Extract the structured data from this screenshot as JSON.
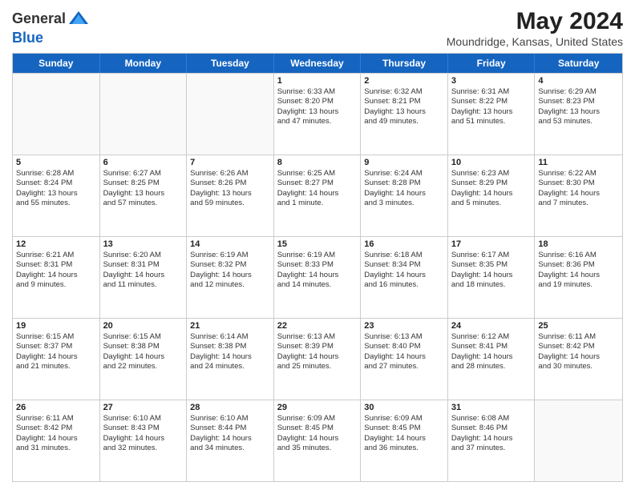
{
  "header": {
    "logo_line1": "General",
    "logo_line2": "Blue",
    "title": "May 2024",
    "subtitle": "Moundridge, Kansas, United States"
  },
  "weekdays": [
    "Sunday",
    "Monday",
    "Tuesday",
    "Wednesday",
    "Thursday",
    "Friday",
    "Saturday"
  ],
  "rows": [
    [
      {
        "day": "",
        "lines": [],
        "empty": true
      },
      {
        "day": "",
        "lines": [],
        "empty": true
      },
      {
        "day": "",
        "lines": [],
        "empty": true
      },
      {
        "day": "1",
        "lines": [
          "Sunrise: 6:33 AM",
          "Sunset: 8:20 PM",
          "Daylight: 13 hours",
          "and 47 minutes."
        ],
        "empty": false
      },
      {
        "day": "2",
        "lines": [
          "Sunrise: 6:32 AM",
          "Sunset: 8:21 PM",
          "Daylight: 13 hours",
          "and 49 minutes."
        ],
        "empty": false
      },
      {
        "day": "3",
        "lines": [
          "Sunrise: 6:31 AM",
          "Sunset: 8:22 PM",
          "Daylight: 13 hours",
          "and 51 minutes."
        ],
        "empty": false
      },
      {
        "day": "4",
        "lines": [
          "Sunrise: 6:29 AM",
          "Sunset: 8:23 PM",
          "Daylight: 13 hours",
          "and 53 minutes."
        ],
        "empty": false
      }
    ],
    [
      {
        "day": "5",
        "lines": [
          "Sunrise: 6:28 AM",
          "Sunset: 8:24 PM",
          "Daylight: 13 hours",
          "and 55 minutes."
        ],
        "empty": false
      },
      {
        "day": "6",
        "lines": [
          "Sunrise: 6:27 AM",
          "Sunset: 8:25 PM",
          "Daylight: 13 hours",
          "and 57 minutes."
        ],
        "empty": false
      },
      {
        "day": "7",
        "lines": [
          "Sunrise: 6:26 AM",
          "Sunset: 8:26 PM",
          "Daylight: 13 hours",
          "and 59 minutes."
        ],
        "empty": false
      },
      {
        "day": "8",
        "lines": [
          "Sunrise: 6:25 AM",
          "Sunset: 8:27 PM",
          "Daylight: 14 hours",
          "and 1 minute."
        ],
        "empty": false
      },
      {
        "day": "9",
        "lines": [
          "Sunrise: 6:24 AM",
          "Sunset: 8:28 PM",
          "Daylight: 14 hours",
          "and 3 minutes."
        ],
        "empty": false
      },
      {
        "day": "10",
        "lines": [
          "Sunrise: 6:23 AM",
          "Sunset: 8:29 PM",
          "Daylight: 14 hours",
          "and 5 minutes."
        ],
        "empty": false
      },
      {
        "day": "11",
        "lines": [
          "Sunrise: 6:22 AM",
          "Sunset: 8:30 PM",
          "Daylight: 14 hours",
          "and 7 minutes."
        ],
        "empty": false
      }
    ],
    [
      {
        "day": "12",
        "lines": [
          "Sunrise: 6:21 AM",
          "Sunset: 8:31 PM",
          "Daylight: 14 hours",
          "and 9 minutes."
        ],
        "empty": false
      },
      {
        "day": "13",
        "lines": [
          "Sunrise: 6:20 AM",
          "Sunset: 8:31 PM",
          "Daylight: 14 hours",
          "and 11 minutes."
        ],
        "empty": false
      },
      {
        "day": "14",
        "lines": [
          "Sunrise: 6:19 AM",
          "Sunset: 8:32 PM",
          "Daylight: 14 hours",
          "and 12 minutes."
        ],
        "empty": false
      },
      {
        "day": "15",
        "lines": [
          "Sunrise: 6:19 AM",
          "Sunset: 8:33 PM",
          "Daylight: 14 hours",
          "and 14 minutes."
        ],
        "empty": false
      },
      {
        "day": "16",
        "lines": [
          "Sunrise: 6:18 AM",
          "Sunset: 8:34 PM",
          "Daylight: 14 hours",
          "and 16 minutes."
        ],
        "empty": false
      },
      {
        "day": "17",
        "lines": [
          "Sunrise: 6:17 AM",
          "Sunset: 8:35 PM",
          "Daylight: 14 hours",
          "and 18 minutes."
        ],
        "empty": false
      },
      {
        "day": "18",
        "lines": [
          "Sunrise: 6:16 AM",
          "Sunset: 8:36 PM",
          "Daylight: 14 hours",
          "and 19 minutes."
        ],
        "empty": false
      }
    ],
    [
      {
        "day": "19",
        "lines": [
          "Sunrise: 6:15 AM",
          "Sunset: 8:37 PM",
          "Daylight: 14 hours",
          "and 21 minutes."
        ],
        "empty": false
      },
      {
        "day": "20",
        "lines": [
          "Sunrise: 6:15 AM",
          "Sunset: 8:38 PM",
          "Daylight: 14 hours",
          "and 22 minutes."
        ],
        "empty": false
      },
      {
        "day": "21",
        "lines": [
          "Sunrise: 6:14 AM",
          "Sunset: 8:38 PM",
          "Daylight: 14 hours",
          "and 24 minutes."
        ],
        "empty": false
      },
      {
        "day": "22",
        "lines": [
          "Sunrise: 6:13 AM",
          "Sunset: 8:39 PM",
          "Daylight: 14 hours",
          "and 25 minutes."
        ],
        "empty": false
      },
      {
        "day": "23",
        "lines": [
          "Sunrise: 6:13 AM",
          "Sunset: 8:40 PM",
          "Daylight: 14 hours",
          "and 27 minutes."
        ],
        "empty": false
      },
      {
        "day": "24",
        "lines": [
          "Sunrise: 6:12 AM",
          "Sunset: 8:41 PM",
          "Daylight: 14 hours",
          "and 28 minutes."
        ],
        "empty": false
      },
      {
        "day": "25",
        "lines": [
          "Sunrise: 6:11 AM",
          "Sunset: 8:42 PM",
          "Daylight: 14 hours",
          "and 30 minutes."
        ],
        "empty": false
      }
    ],
    [
      {
        "day": "26",
        "lines": [
          "Sunrise: 6:11 AM",
          "Sunset: 8:42 PM",
          "Daylight: 14 hours",
          "and 31 minutes."
        ],
        "empty": false
      },
      {
        "day": "27",
        "lines": [
          "Sunrise: 6:10 AM",
          "Sunset: 8:43 PM",
          "Daylight: 14 hours",
          "and 32 minutes."
        ],
        "empty": false
      },
      {
        "day": "28",
        "lines": [
          "Sunrise: 6:10 AM",
          "Sunset: 8:44 PM",
          "Daylight: 14 hours",
          "and 34 minutes."
        ],
        "empty": false
      },
      {
        "day": "29",
        "lines": [
          "Sunrise: 6:09 AM",
          "Sunset: 8:45 PM",
          "Daylight: 14 hours",
          "and 35 minutes."
        ],
        "empty": false
      },
      {
        "day": "30",
        "lines": [
          "Sunrise: 6:09 AM",
          "Sunset: 8:45 PM",
          "Daylight: 14 hours",
          "and 36 minutes."
        ],
        "empty": false
      },
      {
        "day": "31",
        "lines": [
          "Sunrise: 6:08 AM",
          "Sunset: 8:46 PM",
          "Daylight: 14 hours",
          "and 37 minutes."
        ],
        "empty": false
      },
      {
        "day": "",
        "lines": [],
        "empty": true
      }
    ]
  ]
}
